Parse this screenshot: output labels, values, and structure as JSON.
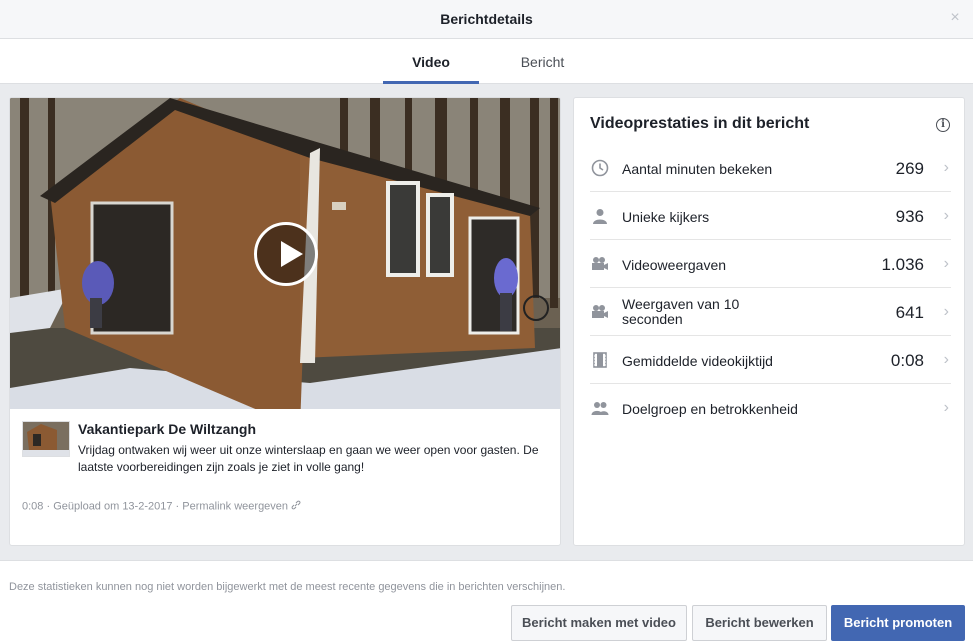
{
  "header": {
    "title": "Berichtdetails",
    "close": "×"
  },
  "tabs": [
    {
      "label": "Video",
      "active": true
    },
    {
      "label": "Bericht",
      "active": false
    }
  ],
  "post": {
    "page_name": "Vakantiepark De Wiltzangh",
    "text": "Vrijdag ontwaken wij weer uit onze winterslaap en gaan we weer open voor gasten. De laatste voorbereidingen zijn zoals je ziet in volle gang!",
    "duration": "0:08",
    "separator": "·",
    "uploaded": "Geüpload om 13-2-2017",
    "separator2": "·",
    "permalink": "Permalink weergeven"
  },
  "stats": {
    "title": "Videoprestaties in dit bericht",
    "info_icon": "i",
    "rows": [
      {
        "icon": "clock-icon",
        "label": "Aantal minuten bekeken",
        "value": "269"
      },
      {
        "icon": "person-icon",
        "label": "Unieke kijkers",
        "value": "936"
      },
      {
        "icon": "video-camera-icon",
        "label": "Videoweergaven",
        "value": "1.036"
      },
      {
        "icon": "video-camera-icon",
        "label": "Weergaven van 10 seconden",
        "value": "641"
      },
      {
        "icon": "film-icon",
        "label": "Gemiddelde videokijktijd",
        "value": "0:08"
      },
      {
        "icon": "people-icon",
        "label": "Doelgroep en betrokkenheid",
        "value": ""
      }
    ]
  },
  "footer": {
    "note": "Deze statistieken kunnen nog niet worden bijgewerkt met de meest recente gegevens die in berichten verschijnen.",
    "buttons": {
      "create": "Bericht maken met video",
      "edit": "Bericht bewerken",
      "promote": "Bericht promoten"
    }
  },
  "colors": {
    "accent": "#4267b2",
    "background": "#e9ebee"
  }
}
